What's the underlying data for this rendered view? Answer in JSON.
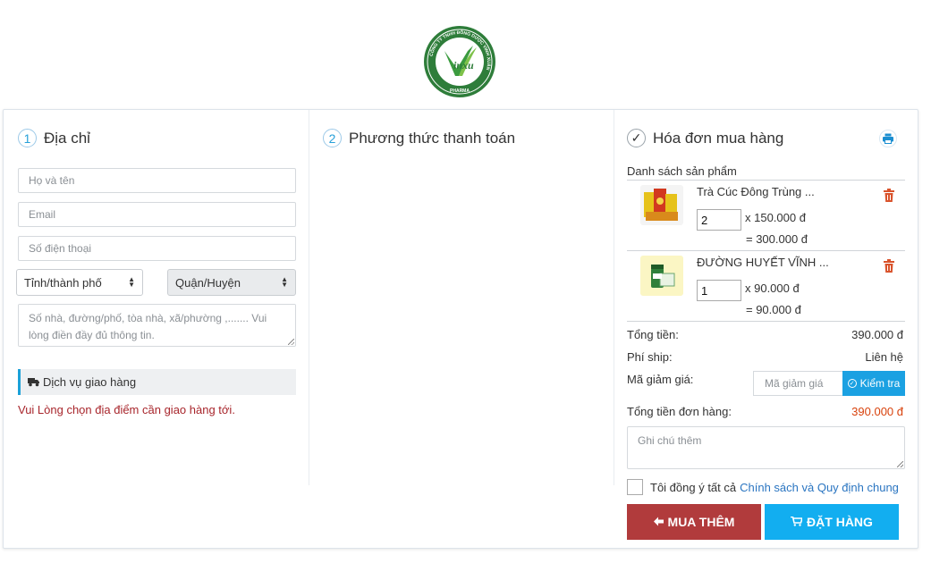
{
  "logo": {
    "ring_text": "CÔNG TY TNHH ĐÔNG DƯỢC VINH XUÂN",
    "brand": "inxu",
    "sub": "PHARMA"
  },
  "address": {
    "step_num": "1",
    "title": "Địa chỉ",
    "name_placeholder": "Họ và tên",
    "email_placeholder": "Email",
    "phone_placeholder": "Số điện thoại",
    "province_selected": "Tỉnh/thành phố",
    "district_selected": "Quận/Huyện",
    "street_placeholder": "Số nhà, đường/phố, tòa nhà, xã/phường ,....... Vui lòng điền đầy đủ thông tin.",
    "shipping_title": "Dịch vụ giao hàng",
    "shipping_warning": "Vui Lòng chọn địa điểm cần giao hàng tới."
  },
  "payment": {
    "step_num": "2",
    "title": "Phương thức thanh toán"
  },
  "invoice": {
    "title": "Hóa đơn mua hàng",
    "list_label": "Danh sách sản phẩm",
    "products": [
      {
        "name": "Trà Cúc Đông Trùng ...",
        "qty": "2",
        "unit_price": "x 150.000 đ",
        "subtotal": "= 300.000 đ"
      },
      {
        "name": "ĐƯỜNG HUYẾT VĨNH ...",
        "qty": "1",
        "unit_price": "x 90.000 đ",
        "subtotal": "= 90.000 đ"
      }
    ],
    "total_label": "Tổng tiền:",
    "total_value": "390.000 đ",
    "ship_label": "Phí ship:",
    "ship_value": "Liên hệ",
    "coupon_label": "Mã giảm giá:",
    "coupon_placeholder": "Mã giảm giá",
    "coupon_button": "Kiểm tra",
    "order_total_label": "Tổng tiền đơn hàng:",
    "order_total_value": "390.000 đ",
    "note_placeholder": "Ghi chú thêm",
    "agree_text": "Tôi đồng ý tất cả",
    "agree_link": "Chính sách và Quy định chung",
    "back_button": "MUA THÊM",
    "order_button": "ĐẶT HÀNG"
  },
  "colors": {
    "accent_blue": "#1ba1e2",
    "danger_red": "#b13b3c",
    "price_red": "#d8420c",
    "warning_text": "#a8262c",
    "logo_green": "#2e8b3e"
  }
}
